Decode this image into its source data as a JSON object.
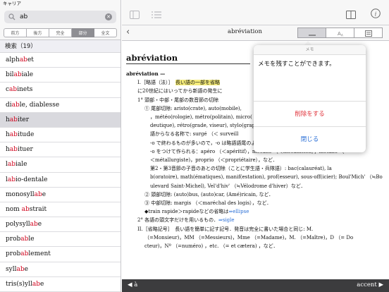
{
  "status": {
    "carrier": "キャリア"
  },
  "search": {
    "query": "ab"
  },
  "segments": [
    "前方",
    "後方",
    "完全",
    "部分",
    "全文"
  ],
  "active_segment": "部分",
  "results_header": "検索（19）",
  "results": [
    {
      "pre": "alph",
      "hl": "ab",
      "post": "et"
    },
    {
      "pre": "bil",
      "hl": "ab",
      "post": "iale"
    },
    {
      "pre": "c",
      "hl": "ab",
      "post": "inets"
    },
    {
      "pre": "di",
      "hl": "ab",
      "post": "le, diablesse"
    },
    {
      "pre": "h",
      "hl": "ab",
      "post": "iter"
    },
    {
      "pre": "h",
      "hl": "ab",
      "post": "itude"
    },
    {
      "pre": "h",
      "hl": "ab",
      "post": "ituer"
    },
    {
      "pre": "l",
      "hl": "ab",
      "post": "iale"
    },
    {
      "pre": "l",
      "hl": "ab",
      "post": "io-dentale"
    },
    {
      "pre": "monosyll",
      "hl": "ab",
      "post": "e"
    },
    {
      "pre": "nom ",
      "hl": "ab",
      "post": "strait"
    },
    {
      "pre": "polysyll",
      "hl": "ab",
      "post": "e"
    },
    {
      "pre": "prob",
      "hl": "ab",
      "post": "le"
    },
    {
      "pre": "prob",
      "hl": "ab",
      "post": "lement"
    },
    {
      "pre": "syll",
      "hl": "ab",
      "post": "e"
    },
    {
      "pre": "tris(s)yll",
      "hl": "ab",
      "post": "e"
    }
  ],
  "selected_index": 4,
  "nav": {
    "title": "abréviation",
    "back": "‹"
  },
  "entry": {
    "headword": "abréviation",
    "lines": [
      {
        "cls": "sub",
        "text": "abréviation —"
      },
      {
        "cls": "ind1",
        "parts": [
          [
            "I.［略語（法）］　",
            ""
          ],
          [
            "長い語の一部を省略",
            "ylw"
          ],
          [
            "",
            ""
          ]
        ]
      },
      {
        "cls": "ind1",
        "parts": [
          [
            "に20世紀にはいってから新語の発生に",
            ""
          ]
        ]
      },
      {
        "cls": "ind1",
        "parts": [
          [
            "1° 頭部・中部・尾部の数音節の切除",
            ""
          ]
        ]
      },
      {
        "cls": "ind2",
        "parts": [
          [
            "① 尾部切除: aristo(crate), auto(mobile),",
            ""
          ]
        ]
      },
      {
        "cls": "ind3",
        "parts": [
          [
            "，météo(rologie), métro(politain), micro(",
            ""
          ]
        ]
      },
      {
        "cls": "ind3",
        "parts": [
          [
            "deutique), rétro(grade, viseur), stylo(grap",
            ""
          ]
        ]
      },
      {
        "cls": "ind3",
        "parts": [
          [
            "語からなる名称で: surgé （＜ surveill",
            ""
          ]
        ]
      },
      {
        "cls": "ind3",
        "parts": [
          [
            "-o で終わるものが多いので，-o は略語語尾のような役割を",
            ""
          ]
        ]
      },
      {
        "cls": "ind3",
        "parts": [
          [
            "-o をつけて作られる：apéro （＜apéritif），mécano （＜mécanicien），métallo （",
            ""
          ]
        ]
      },
      {
        "cls": "ind3",
        "parts": [
          [
            "＜métallurgiste)，proprio （＜propriétaire），など．",
            ""
          ]
        ]
      },
      {
        "cls": "ind3",
        "parts": [
          [
            "第2・第3音節の子音のあとの切除（ことに学生語・兵隊語）: bac(calauréat), la",
            ""
          ]
        ]
      },
      {
        "cls": "ind3",
        "parts": [
          [
            "b(oratoire), math(ématiques), manif(estation), prof(esseur), sous-off(icier); Boul'Mich' （≒Bo",
            ""
          ]
        ]
      },
      {
        "cls": "ind3",
        "parts": [
          [
            "ulevard Saint-Michel), Vel'd'hiv' （≒Vélodrome d'hiver）など．",
            ""
          ]
        ]
      },
      {
        "cls": "ind2",
        "parts": [
          [
            "② 頭部切除: (auto)bus, (auto)car, (Amé)ricain, など．",
            ""
          ]
        ]
      },
      {
        "cls": "ind2",
        "parts": [
          [
            "③ 中部切除: margis （＜maréchal des logis），など．",
            ""
          ]
        ]
      },
      {
        "cls": "ind2",
        "parts": [
          [
            "◆train rapide＞rapideなどの省略は",
            ""
          ],
          [
            "⇒ellipse",
            "link"
          ]
        ]
      },
      {
        "cls": "ind1",
        "parts": [
          [
            "2° 各語の頭文字だけを用いるもの．",
            ""
          ],
          [
            "⇒sigle",
            "link"
          ]
        ]
      },
      {
        "cls": "ind1",
        "parts": [
          [
            "II.［省略記号］　長い語を簡単に記す記号．発音は完全に書いた場合と同じ: M.",
            ""
          ]
        ]
      },
      {
        "cls": "ind2",
        "parts": [
          [
            "（=Monsieur)，MM （=Messieurs)，Mme （=Madame)，M. （=Maître)，D （= Do",
            ""
          ]
        ]
      },
      {
        "cls": "ind2",
        "parts": [
          [
            "cteur)，Nº （=numéro) ，etc. （= et cætera) ，など．",
            ""
          ]
        ]
      }
    ]
  },
  "bottom": {
    "prev": "◀ à",
    "next": "accent ▶"
  },
  "memo": {
    "title": "メモ",
    "text": "メモを残すことができます。",
    "delete_label": "削除をする",
    "close_label": "閉じる"
  },
  "colors": {
    "highlight": "#d0021b",
    "link": "#2a6fd6",
    "delete": "#e0323a"
  }
}
